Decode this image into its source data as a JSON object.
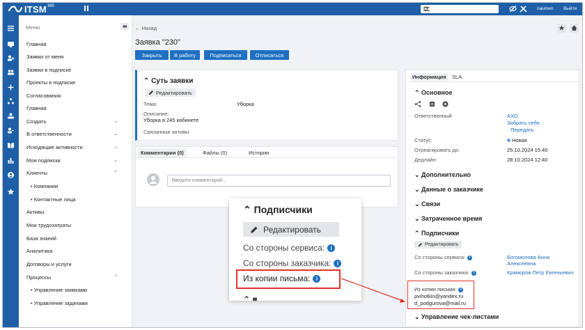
{
  "topbar": {
    "logo_text": "ITSM",
    "logo_sup": "365",
    "pin_icon": "pin-icon",
    "search_placeholder": "",
    "user": "naumen",
    "logout": "Выйти"
  },
  "menu": {
    "header": "Меню",
    "items": [
      {
        "label": "Главная",
        "chev": ""
      },
      {
        "label": "Заявки от меня",
        "chev": ""
      },
      {
        "label": "Заявки в подписке",
        "chev": ""
      },
      {
        "label": "Проекты в подписке",
        "chev": ""
      },
      {
        "label": "Согласования",
        "chev": ""
      },
      {
        "label": "Главная",
        "chev": ""
      },
      {
        "label": "Создать",
        "chev": "⌄"
      },
      {
        "label": "В ответственности",
        "chev": "⌄"
      },
      {
        "label": "Исходящие активности",
        "chev": "⌄"
      },
      {
        "label": "Мои подписки",
        "chev": "⌄"
      },
      {
        "label": "Клиенты",
        "chev": "⌃"
      },
      {
        "label": "• Компании",
        "chev": ""
      },
      {
        "label": "• Контактные лица",
        "chev": ""
      },
      {
        "label": "Активы",
        "chev": ""
      },
      {
        "label": "Мои трудозатраты",
        "chev": ""
      },
      {
        "label": "База знаний",
        "chev": ""
      },
      {
        "label": "Аналитика",
        "chev": ""
      },
      {
        "label": "Договоры и услуги",
        "chev": ""
      },
      {
        "label": "Процессы",
        "chev": "⌃"
      },
      {
        "label": "• Управление заявками",
        "chev": ""
      },
      {
        "label": "• Управление задачами",
        "chev": ""
      }
    ]
  },
  "main": {
    "back": "← Назад",
    "title": "Заявка \"230\"",
    "buttons": [
      "Закрыть",
      "В работу",
      "Подписаться",
      "Отписаться"
    ],
    "essence": {
      "title": "Суть заявки",
      "edit": "Редактировать",
      "topic_label": "Тема:",
      "topic_value": "Уборка",
      "desc_label": "Описание:",
      "desc_value": "Уборка в 245 кабинете",
      "assets_label": "Связанные активы:"
    },
    "tabs": [
      "Комментарии (0)",
      "Файлы (0)",
      "История"
    ],
    "comment_placeholder": "Введите комментарий..."
  },
  "info": {
    "tabs": [
      "Информация",
      "SLA"
    ],
    "basic_title": "Основное",
    "responsible_label": "Ответственный:",
    "responsible_value": "АХО",
    "take_self": "Забрать себе",
    "transfer": "Передать",
    "status_label": "Статус:",
    "status_value": "Новая",
    "react_label": "Отреагировать до:",
    "react_value": "25.10.2024 15:40",
    "deadline_label": "Дедлайн:",
    "deadline_value": "28.10.2024 12:40",
    "sections": [
      "Дополнительно",
      "Данные о заказчике",
      "Связи",
      "Затраченное время",
      "Подписчики"
    ],
    "subs_edit": "Редактировать",
    "service_label": "Со стороны сервиса:",
    "service_value": "Богомолова Анна Алексеевна",
    "customer_label": "Со стороны заказчика:",
    "customer_value": "Краморов Петр Евгеньевич",
    "copy_label": "Из копии письма:",
    "copy_emails": [
      "pvihotkin@yandex.ru",
      "d_podgurova@mail.ru"
    ],
    "checklists": "Управление чек-листами",
    "status_color": "#67a5e4"
  },
  "zoom": {
    "title": "Подписчики",
    "edit": "Редактировать",
    "service": "Со стороны сервиса:",
    "customer": "Со стороны заказчика:",
    "copy": "Из копии письма:"
  },
  "colors": {
    "brand": "#1e5fa8",
    "button": "#1e70c1",
    "highlight": "#e0312a"
  }
}
